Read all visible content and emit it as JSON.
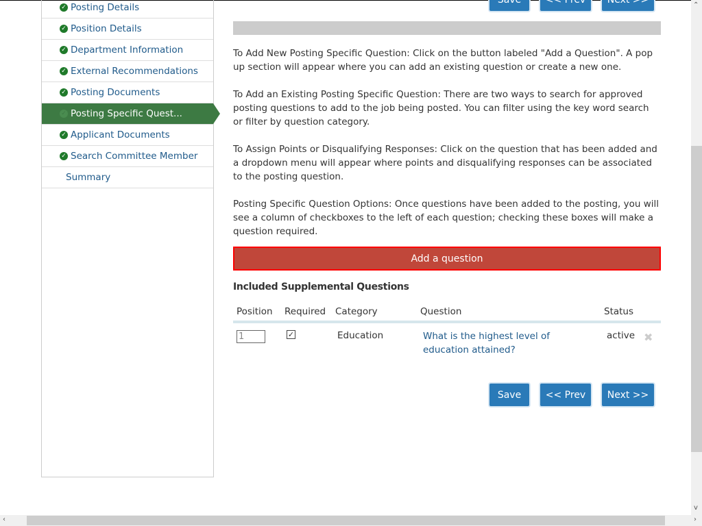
{
  "sidebar": {
    "items": [
      {
        "label": "Posting Details",
        "done": true
      },
      {
        "label": "Position Details",
        "done": true
      },
      {
        "label": "Department Information",
        "done": true
      },
      {
        "label": "External Recommendations",
        "done": true
      },
      {
        "label": "Posting Documents",
        "done": true
      },
      {
        "label": "Posting Specific Quest...",
        "done": true,
        "active": true
      },
      {
        "label": "Applicant Documents",
        "done": true
      },
      {
        "label": "Search Committee Member",
        "done": true
      },
      {
        "label": "Summary",
        "done": false
      }
    ]
  },
  "buttons": {
    "save": "Save",
    "prev": "<< Prev",
    "next": "Next >>"
  },
  "instructions": [
    "To Add New Posting Specific Question: Click on the button labeled \"Add a Question\". A pop up section will appear where you can add an existing question or create a new one.",
    "To Add an Existing Posting Specific Question: There are two ways to search for approved posting questions to add to the job being posted. You can filter using the key word search or filter by question category.",
    "To Assign Points or Disqualifying Responses: Click on the question that has been added and a dropdown menu will appear where points and disqualifying responses can be associated to the posting question.",
    "Posting Specific Question Options: Once questions have been added to the posting, you will see a column of checkboxes to the left of each question; checking these boxes will make a question required."
  ],
  "add_question_label": "Add a question",
  "section_title": "Included Supplemental Questions",
  "table": {
    "headers": [
      "Position",
      "Required",
      "Category",
      "Question",
      "Status"
    ],
    "rows": [
      {
        "position": "1",
        "required": true,
        "category": "Education",
        "question": "What is the highest level of education attained?",
        "status": "active"
      }
    ]
  },
  "colors": {
    "active_nav": "#3d7a43",
    "button": "#2a7ab8",
    "add_question": "#c0473a",
    "link": "#1f5a8a"
  }
}
